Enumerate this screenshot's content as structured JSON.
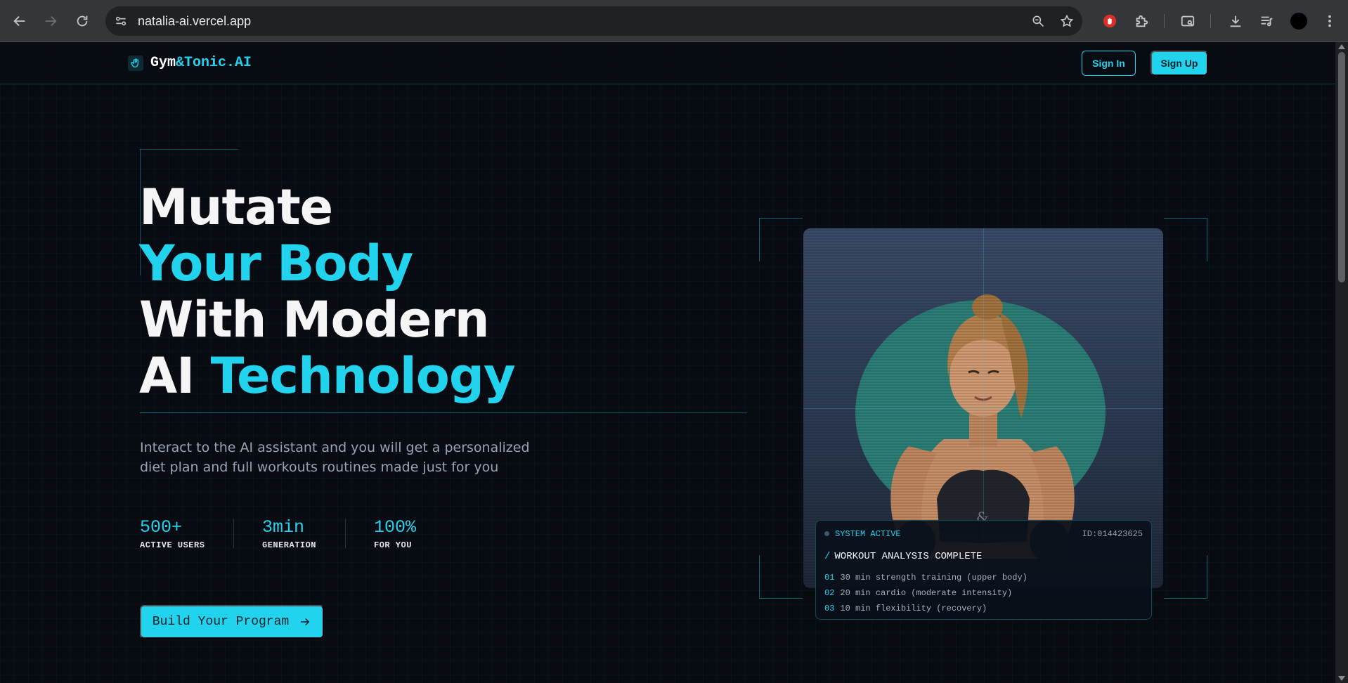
{
  "browser": {
    "url": "natalia-ai.vercel.app"
  },
  "header": {
    "logo_left": "Gym",
    "logo_right": "&Tonic.AI",
    "sign_in": "Sign In",
    "sign_up": "Sign Up"
  },
  "hero": {
    "line1": "Mutate",
    "line2": "Your Body",
    "line3": "With Modern",
    "line4_a": "AI ",
    "line4_b": "Technology",
    "subtitle": "Interact to the AI assistant and you will get a personalized diet plan and full workouts routines made just for you",
    "stats": [
      {
        "value": "500+",
        "label": "ACTIVE USERS"
      },
      {
        "value": "3min",
        "label": "GENERATION"
      },
      {
        "value": "100%",
        "label": "FOR YOU"
      }
    ],
    "cta": "Build Your Program"
  },
  "status_card": {
    "status": "SYSTEM ACTIVE",
    "id": "ID:014423625",
    "title": "WORKOUT ANALYSIS COMPLETE",
    "items": [
      {
        "num": "01",
        "text": "30 min strength training (upper body)"
      },
      {
        "num": "02",
        "text": "20 min cardio (moderate intensity)"
      },
      {
        "num": "03",
        "text": "10 min flexibility (recovery)"
      }
    ]
  },
  "colors": {
    "accent": "#22d3ee",
    "background": "#080b12"
  }
}
